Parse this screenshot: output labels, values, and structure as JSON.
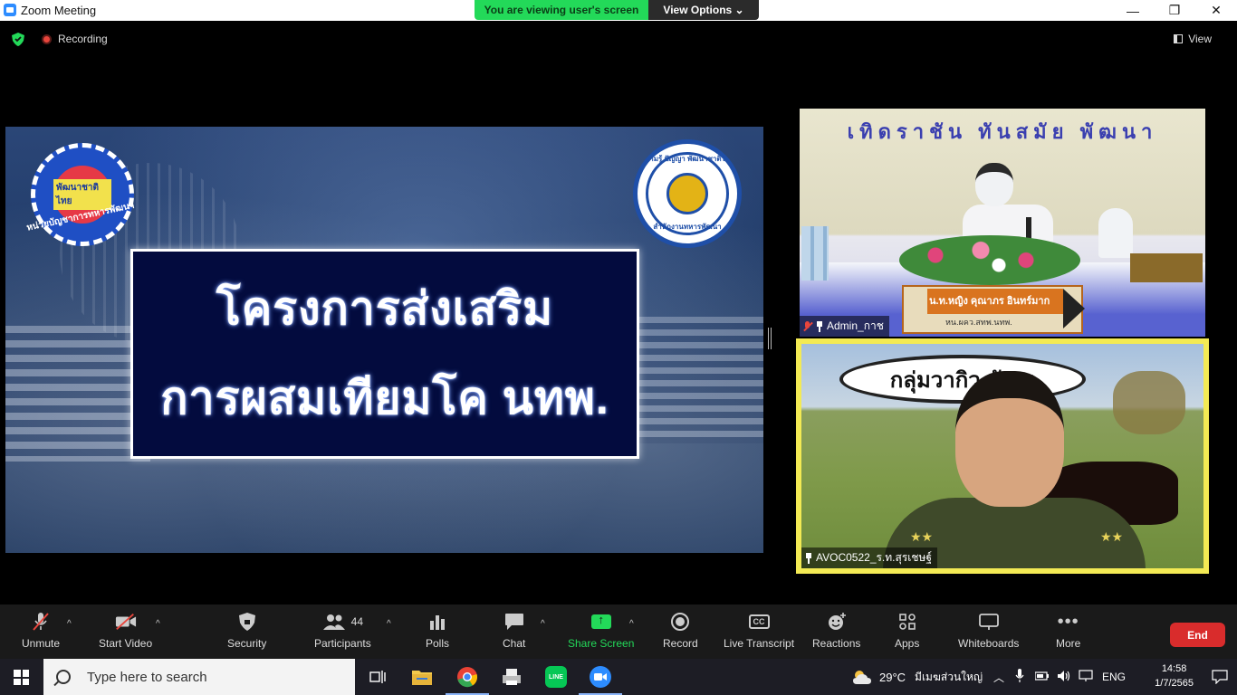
{
  "window": {
    "title": "Zoom Meeting"
  },
  "banner": {
    "viewing_text": "You are viewing user's screen",
    "view_options_label": "View Options ⌄"
  },
  "topbar": {
    "recording_label": "Recording",
    "view_label": "View"
  },
  "share": {
    "title_line1": "โครงการส่งเสริม",
    "title_line2": "การผสมเทียมโค นทพ.",
    "logo_left_text": "พัฒนาชาติไทย",
    "logo_left_caption": "หน่วยบัญชาการทหารพัฒนา",
    "logo_right_top": "ความรู้ ปัญญา พัฒนาชาติไทย",
    "logo_right_bottom": "สำนักงานทหารพัฒนา"
  },
  "video_tiles": [
    {
      "name": "Admin_กาช",
      "banner": "เทิดราชัน   ทันสมัย   พัฒนา",
      "nameplate_name": "น.ท.หญิง คุณาภร  อินทร์มาก",
      "nameplate_role": "หน.ผคว.สทพ.นทพ.",
      "muted": true
    },
    {
      "name": "AVOC0522_ร.ท.สุรเชษฐ์",
      "bubble_text": "กลุ่มวากิว พัฒน",
      "active_speaker": true
    }
  ],
  "toolbar": {
    "unmute": "Unmute",
    "start_video": "Start Video",
    "security": "Security",
    "participants": "Participants",
    "participants_count": "44",
    "polls": "Polls",
    "chat": "Chat",
    "share_screen": "Share Screen",
    "record": "Record",
    "live_transcript": "Live Transcript",
    "reactions": "Reactions",
    "apps": "Apps",
    "whiteboards": "Whiteboards",
    "more": "More",
    "end": "End",
    "cc_badge": "CC"
  },
  "taskbar": {
    "search_placeholder": "Type here to search",
    "weather_temp": "29°C",
    "weather_desc": "มีเมฆส่วนใหญ่",
    "language": "ENG",
    "time": "14:58",
    "date": "1/7/2565",
    "line_label": "LINE"
  },
  "colors": {
    "zoom_blue": "#2d8cff",
    "green": "#23d959",
    "end_red": "#d92c2c",
    "speaker_yellow": "#f3ea54"
  }
}
